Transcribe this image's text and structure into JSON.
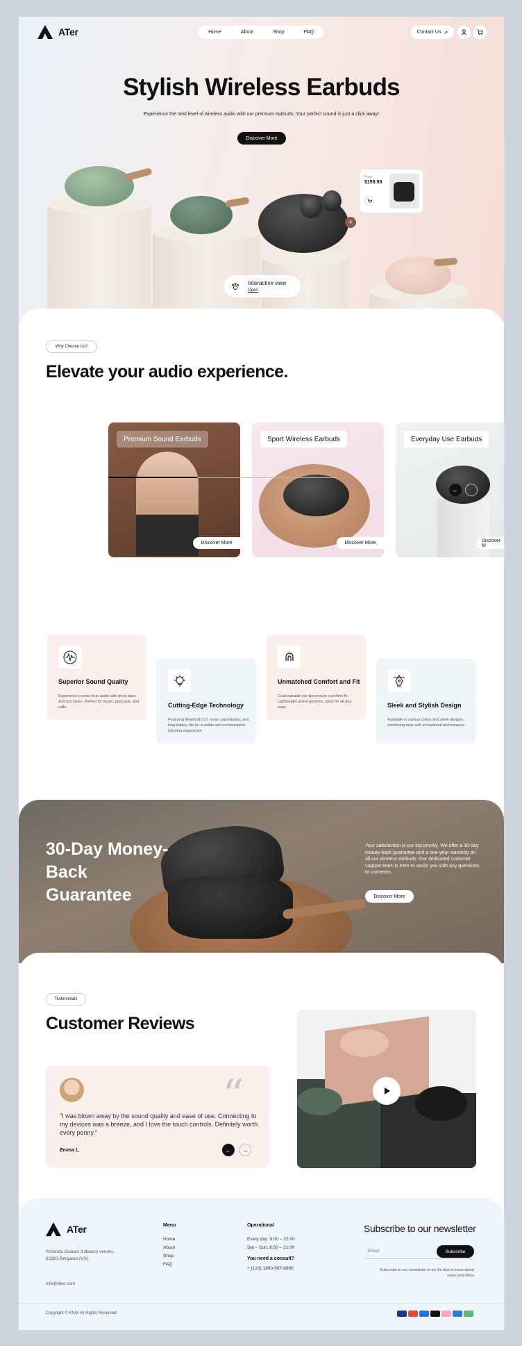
{
  "brand": {
    "name": "ATer"
  },
  "nav": {
    "items": [
      {
        "label": "Home"
      },
      {
        "label": "About"
      },
      {
        "label": "Shop"
      },
      {
        "label": "FAQ"
      }
    ],
    "contact_label": "Contact Us",
    "contact_arrow": "↗"
  },
  "hero": {
    "title": "Stylish Wireless Earbuds",
    "subtitle": "Experience the next level of wireless audio with our premium earbuds. Your perfect sound is just a click away!",
    "cta": "Discover More",
    "price_label": "Price",
    "price_value": "$159.99",
    "interactive_title": "Interactive view",
    "interactive_open": "Open",
    "plus": "+"
  },
  "why": {
    "chip": "Why Choose Us?",
    "title": "Elevate your audio experience.",
    "cards": [
      {
        "label": "Premium Sound Earbuds",
        "button": "Discover More"
      },
      {
        "label": "Sport Wireless Earbuds",
        "button": "Discover More"
      },
      {
        "label": "Everyday Use Earbuds",
        "button": "Discover M"
      }
    ],
    "carousel_progress": 0.39,
    "prev": "←",
    "next": "→"
  },
  "features": [
    {
      "title": "Superior Sound Quality",
      "text": "Experience crystal clear audio with deep bass and rich tones. Perfect for music, podcasts, and calls.",
      "icon": "waveform-icon"
    },
    {
      "title": "Cutting-Edge Technology",
      "text": "Featuring Bluetooth 5.0, noise cancellation, and long battery life for a stable and uninterrupted listening experience.",
      "icon": "chip-brain-icon"
    },
    {
      "title": "Unmatched Comfort and Fit",
      "text": "Customizable ear tips ensure a perfect fit. Lightweight and ergonomic, ideal for all-day wear.",
      "icon": "ear-icon"
    },
    {
      "title": "Sleek and Stylish Design",
      "text": "Available in various colors and sleek designs, combining style with exceptional performance.",
      "icon": "design-pen-icon"
    }
  ],
  "guarantee": {
    "title": "30-Day Money-Back Guarantee",
    "text": "Your satisfaction is our top priority. We offer a 30-day money-back guarantee and a one-year warranty on all our wireless earbuds. Our dedicated customer support team is here to assist you with any questions or concerns.",
    "cta": "Discover More"
  },
  "reviews": {
    "chip": "Testimonials",
    "title": "Customer Reviews",
    "quote": "\"I was blown away by the sound quality and ease of use. Connecting to my devices was a breeze, and I love the touch controls. Definitely worth every penny.\"",
    "author": "Emma L.",
    "quote_mark": "“",
    "prev": "←",
    "next": "→"
  },
  "footer": {
    "address": "Rotonda Giuliani 3 Bianco veneto, 62383 Bergamo (VS)",
    "email": "info@ater.com",
    "menu_title": "Menu",
    "menu": [
      {
        "label": "Home"
      },
      {
        "label": "About"
      },
      {
        "label": "Shop"
      },
      {
        "label": "FAQ"
      }
    ],
    "operational_title": "Operational",
    "hours": [
      "Every day: 9:00 – 22:00",
      "Sat – Sun: 8:00 – 21:00"
    ],
    "consult_title": "You need a consult?",
    "phone": "+ (123) 1800-567-8990",
    "newsletter_title": "Subscribe to our newsletter",
    "email_placeholder": "Email",
    "subscribe": "Subscribe",
    "newsletter_note": "Subscribe to our newsletter to be the first to know about news and offers",
    "copyright": "Copyright © KNIX All Rights Reserved.",
    "payments": [
      "visa-icon",
      "mastercard-icon",
      "paypal-icon",
      "applepay-icon",
      "klarna-icon",
      "amex-icon",
      "shopify-icon"
    ]
  },
  "colors": {
    "accent": "#111111",
    "card_pink": "#fbefec",
    "card_blue": "#eef5f7",
    "footer_bg": "#eef5fb"
  }
}
